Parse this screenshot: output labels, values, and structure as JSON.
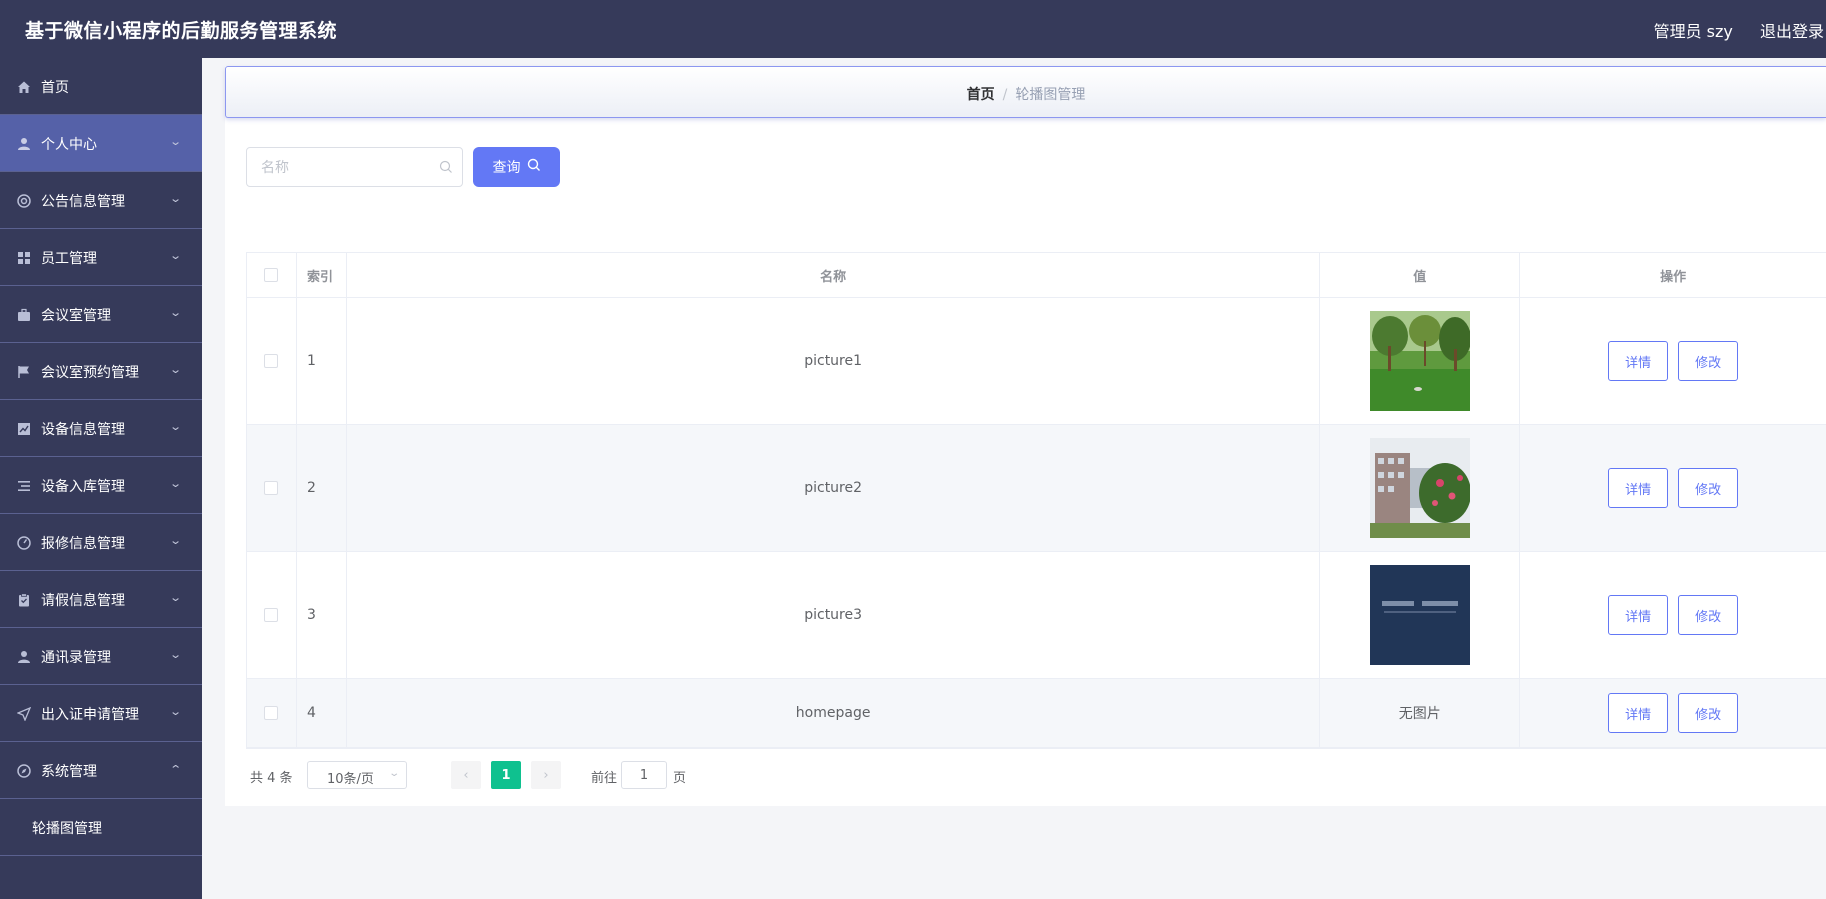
{
  "header": {
    "app_title": "基于微信小程序的后勤服务管理系统",
    "user_label": "管理员 szy",
    "logout_label": "退出登录"
  },
  "sidebar": {
    "items": [
      {
        "label": "首页",
        "icon": "home-icon"
      },
      {
        "label": "个人中心",
        "icon": "user-icon"
      },
      {
        "label": "公告信息管理",
        "icon": "lifebuoy-icon"
      },
      {
        "label": "员工管理",
        "icon": "grid-icon"
      },
      {
        "label": "会议室管理",
        "icon": "briefcase-icon"
      },
      {
        "label": "会议室预约管理",
        "icon": "flag-icon"
      },
      {
        "label": "设备信息管理",
        "icon": "chart-icon"
      },
      {
        "label": "设备入库管理",
        "icon": "list-icon"
      },
      {
        "label": "报修信息管理",
        "icon": "gauge-icon"
      },
      {
        "label": "请假信息管理",
        "icon": "clipboard-icon"
      },
      {
        "label": "通讯录管理",
        "icon": "person-icon"
      },
      {
        "label": "出入证申请管理",
        "icon": "send-icon"
      },
      {
        "label": "系统管理",
        "icon": "compass-icon"
      }
    ],
    "sub_items": [
      {
        "label": "轮播图管理"
      }
    ]
  },
  "breadcrumb": {
    "home": "首页",
    "separator": "/",
    "current": "轮播图管理"
  },
  "search": {
    "placeholder": "名称",
    "query_label": "查询"
  },
  "table": {
    "columns": [
      "索引",
      "名称",
      "值",
      "操作"
    ],
    "rows": [
      {
        "index": "1",
        "name": "picture1",
        "value": "image",
        "detail_label": "详情",
        "edit_label": "修改"
      },
      {
        "index": "2",
        "name": "picture2",
        "value": "image",
        "detail_label": "详情",
        "edit_label": "修改"
      },
      {
        "index": "3",
        "name": "picture3",
        "value": "image",
        "detail_label": "详情",
        "edit_label": "修改"
      },
      {
        "index": "4",
        "name": "homepage",
        "value": "无图片",
        "detail_label": "详情",
        "edit_label": "修改"
      }
    ]
  },
  "pagination": {
    "total": "共 4 条",
    "page_size": "10条/页",
    "current_page": "1",
    "goto_label": "前往",
    "goto_value": "1",
    "page_suffix": "页"
  },
  "colors": {
    "sidebar_bg": "#363a5a",
    "active_item": "#5561a8",
    "primary": "#6378f5",
    "pager_active": "#0fc18f"
  }
}
